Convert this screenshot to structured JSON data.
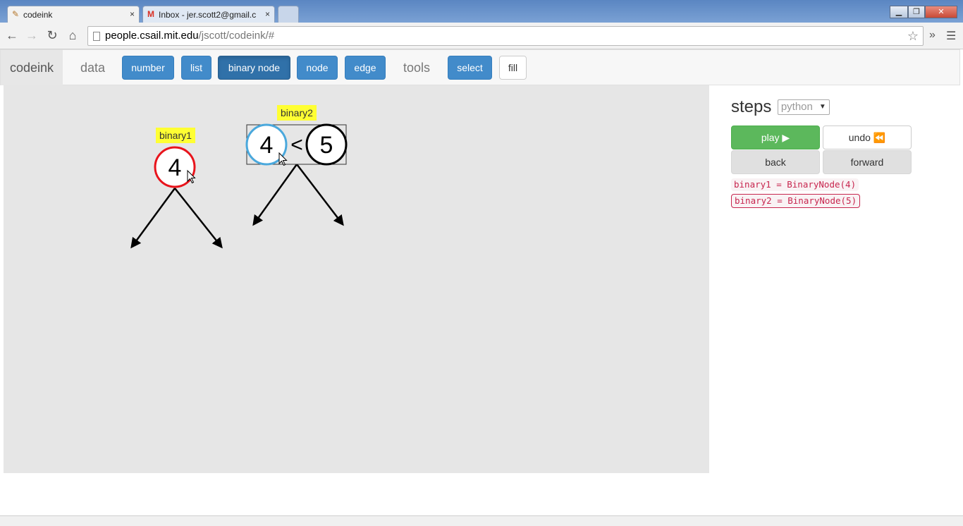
{
  "browser": {
    "tabs": [
      {
        "title": "codeink",
        "icon": "pencil-icon",
        "active": true
      },
      {
        "title": "Inbox - jer.scott2@gmail.c",
        "icon": "gmail-icon",
        "active": false
      }
    ],
    "url_host": "people.csail.mit.edu",
    "url_path": "/jscott/codeink/#",
    "close_glyph": "×",
    "minimize_glyph": "▁",
    "maximize_glyph": "❐",
    "window_close_glyph": "✕"
  },
  "nav": {
    "brand": "codeink",
    "data_label": "data",
    "data_buttons": [
      "number",
      "list",
      "binary node",
      "node",
      "edge"
    ],
    "active_button": "binary node",
    "tools_label": "tools",
    "tool_buttons": [
      "select",
      "fill"
    ]
  },
  "canvas": {
    "nodes": [
      {
        "label": "binary1",
        "value": "4",
        "stroke": "#e8141c"
      },
      {
        "label": "binary2",
        "value": "4",
        "stroke": "#4aa8dc",
        "compare": "<",
        "other_value": "5",
        "other_stroke": "#000000"
      }
    ]
  },
  "steps": {
    "title": "steps",
    "language": "python",
    "play_label": "play ▶",
    "undo_label": "undo ⏪",
    "back_label": "back",
    "forward_label": "forward",
    "lines": [
      {
        "code": "binary1 = BinaryNode(4)",
        "selected": false
      },
      {
        "code": "binary2 = BinaryNode(5)",
        "selected": true
      }
    ]
  },
  "colors": {
    "primary": "#428bca",
    "success": "#5cb85c",
    "label_bg": "#ffff33",
    "code_fg": "#c7254e"
  }
}
